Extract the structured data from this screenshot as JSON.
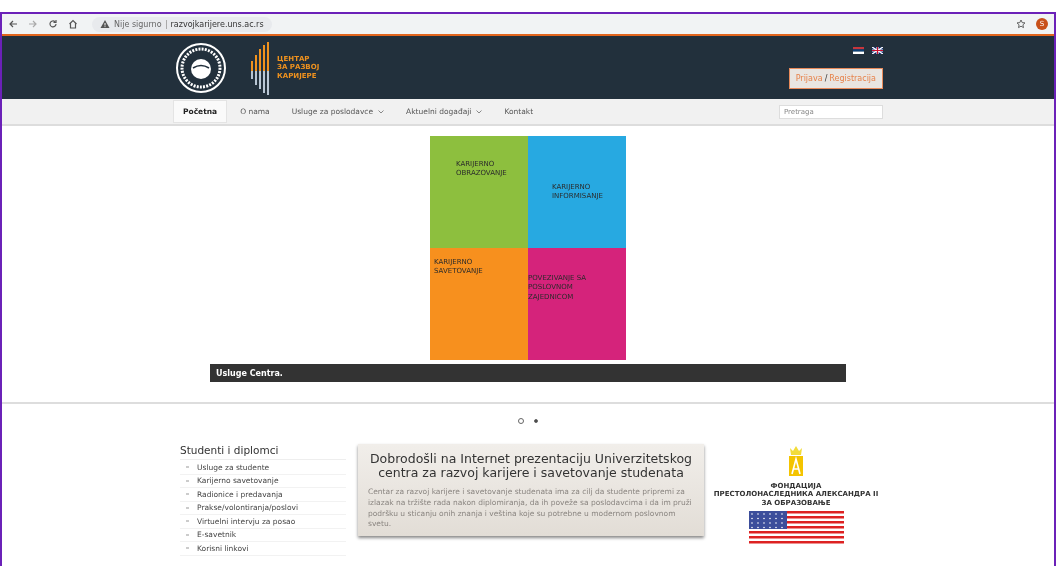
{
  "browser": {
    "security": "Nije sigurno",
    "url": "razvojkarijere.uns.ac.rs",
    "profile": "S"
  },
  "header": {
    "logo_lines": [
      "ЦЕНТАР",
      "ЗА РАЗВОЈ",
      "КАРИЈЕРЕ"
    ],
    "login": "Prijava",
    "separator": "/",
    "register": "Registracija"
  },
  "nav": {
    "items": [
      {
        "label": "Početna",
        "selected": true,
        "dropdown": false
      },
      {
        "label": "O nama",
        "selected": false,
        "dropdown": false
      },
      {
        "label": "Usluge za poslodavce",
        "selected": false,
        "dropdown": true
      },
      {
        "label": "Aktuelni događaji",
        "selected": false,
        "dropdown": true
      },
      {
        "label": "Kontakt",
        "selected": false,
        "dropdown": false
      }
    ],
    "search": {
      "placeholder": "Pretraga"
    }
  },
  "slider": {
    "pieces": [
      {
        "text": "KARIJERNO OBRAZOVANJE",
        "color": "#8dbf3e"
      },
      {
        "text": "KARIJERNO INFORMISANJE",
        "color": "#27a9e1"
      },
      {
        "text": "KARIJERNO SAVETOVANJE",
        "color": "#f7901e"
      },
      {
        "text": "POVEZIVANJE SA POSLOVNOM ZAJEDNICOM",
        "color": "#d5237b"
      }
    ],
    "caption": "Usluge Centra.",
    "dots": [
      {
        "selected": false
      },
      {
        "selected": true
      }
    ]
  },
  "sidebar": {
    "title": "Studenti i diplomci",
    "items": [
      "Usluge za studente",
      "Karijerno savetovanje",
      "Radionice i predavanja",
      "Prakse/volontiranja/poslovi",
      "Virtuelni intervju za posao",
      "E-savetnik",
      "Korisni linkovi"
    ]
  },
  "welcome": {
    "title": "Dobrodošli na Internet prezentaciju Univerzitetskog centra za razvoj karijere i savetovanje studenata",
    "text": "Centar za razvoj karijere i savetovanje studenata ima za cilj da studente pripremi za izlazak na tržište rada nakon diplomiranja, da ih poveže sa poslodavcima i da im pruži podršku u sticanju onih znanja i veština koje su potrebne u modernom poslovnom svetu."
  },
  "sponsor": {
    "lines": [
      "ФОНДАЦИЈА",
      "ПРЕСТОЛОНАСЛЕДНИКА АЛЕКСАНДРА II",
      "ЗА ОБРАЗОВАЊЕ"
    ]
  }
}
